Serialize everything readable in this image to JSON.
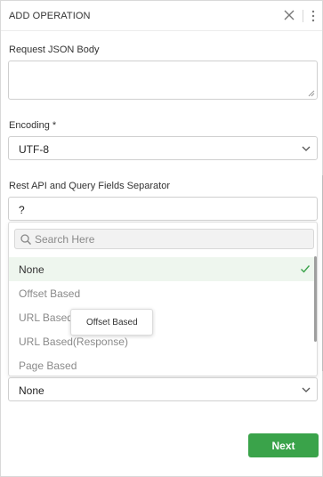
{
  "header": {
    "title": "ADD OPERATION",
    "close_icon": "close-icon",
    "menu_icon": "kebab-menu-icon"
  },
  "request_json_body": {
    "label": "Request JSON Body",
    "value": ""
  },
  "encoding": {
    "label": "Encoding *",
    "value": "UTF-8"
  },
  "separator": {
    "label": "Rest API and Query Fields Separator",
    "value": "?"
  },
  "dropdown": {
    "search_placeholder": "Search Here",
    "options": [
      {
        "label": "None",
        "selected": true
      },
      {
        "label": "Offset Based",
        "selected": false
      },
      {
        "label": "URL Based",
        "selected": false
      },
      {
        "label": "URL Based(Response)",
        "selected": false
      },
      {
        "label": "Page Based",
        "selected": false
      }
    ],
    "tooltip": "Offset Based"
  },
  "pagination": {
    "value": "None"
  },
  "footer": {
    "next_label": "Next"
  },
  "colors": {
    "accent_green": "#3aa34a",
    "selected_bg": "#eef6ee",
    "check_green": "#3aa34a"
  }
}
